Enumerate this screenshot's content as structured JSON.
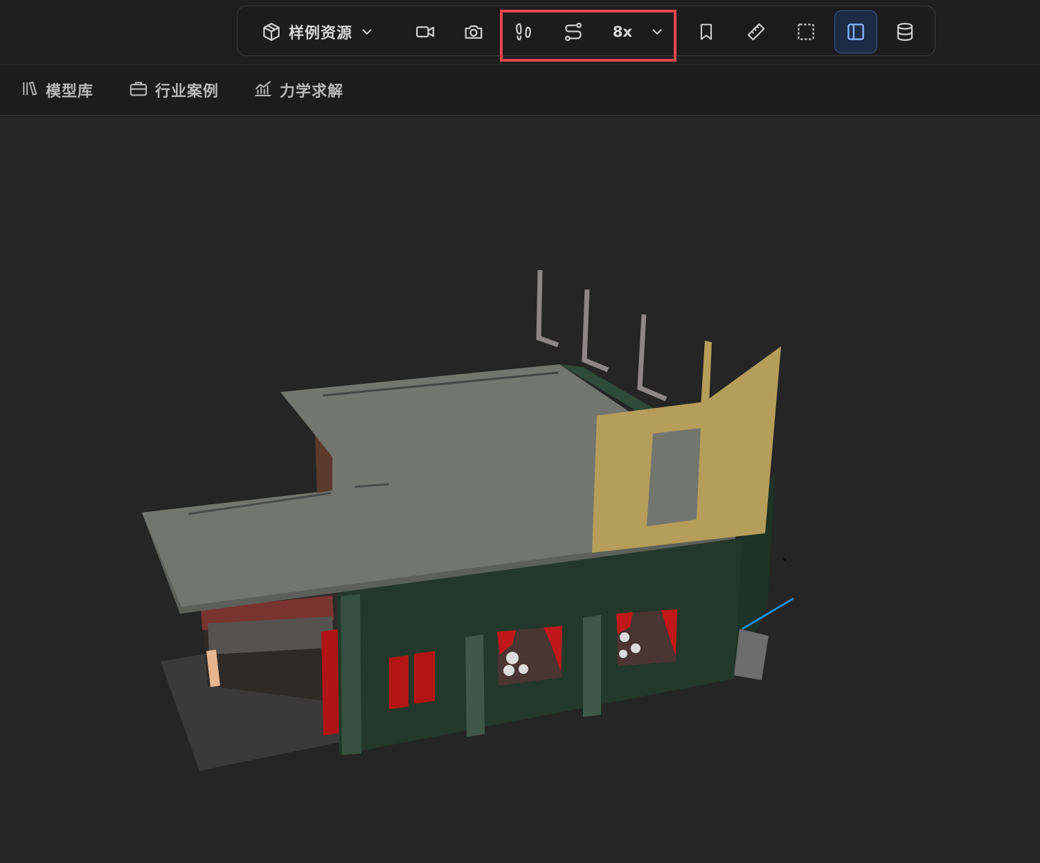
{
  "toolbar": {
    "sample_resources_label": "样例资源",
    "speed_label": "8x",
    "buttons": [
      "cube-icon",
      "video-icon",
      "camera-icon",
      "footsteps-icon",
      "route-icon",
      "speed-dropdown",
      "bookmark-icon",
      "ruler-icon",
      "box-select-icon",
      "sidebar-panel-icon",
      "database-icon"
    ],
    "active_button": "sidebar-panel-icon",
    "highlight_color": "#e5484d",
    "active_color": "#3c5a8f"
  },
  "nav": {
    "items": [
      {
        "label": "模型库",
        "icon": "library-icon"
      },
      {
        "label": "行业案例",
        "icon": "briefcase-icon"
      },
      {
        "label": "力学求解",
        "icon": "chart-icon"
      }
    ]
  },
  "viewport": {
    "background": "#252525",
    "model": "3d-building"
  }
}
